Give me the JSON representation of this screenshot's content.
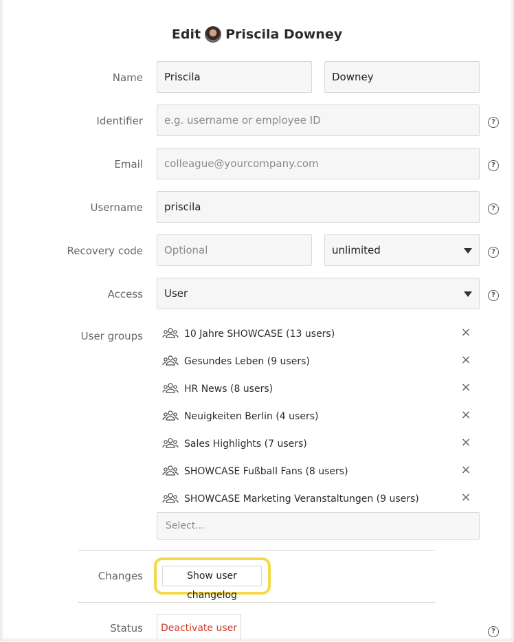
{
  "title": {
    "prefix": "Edit",
    "name": "Priscila Downey"
  },
  "form": {
    "name_label": "Name",
    "first_name_value": "Priscila",
    "last_name_value": "Downey",
    "identifier_label": "Identifier",
    "identifier_placeholder": "e.g. username or employee ID",
    "email_label": "Email",
    "email_placeholder": "colleague@yourcompany.com",
    "username_label": "Username",
    "username_value": "priscila",
    "recovery_label": "Recovery code",
    "recovery_placeholder": "Optional",
    "recovery_validity": "unlimited",
    "access_label": "Access",
    "access_value": "User",
    "groups_label": "User groups",
    "groups": [
      "10 Jahre SHOWCASE (13 users)",
      "Gesundes Leben (9 users)",
      "HR News (8 users)",
      "Neuigkeiten Berlin (4 users)",
      "Sales Highlights (7 users)",
      "SHOWCASE Fußball Fans (8 users)",
      "SHOWCASE Marketing Veranstaltungen (9 users)"
    ],
    "groups_select_placeholder": "Select...",
    "changes_label": "Changes",
    "changelog_button": "Show user changelog",
    "status_label": "Status",
    "deactivate_button": "Deactivate user"
  },
  "icons": {
    "help": "?",
    "remove": "×",
    "group": "group-icon"
  },
  "colors": {
    "highlight": "#f1d94a",
    "danger": "#d03a2b"
  }
}
